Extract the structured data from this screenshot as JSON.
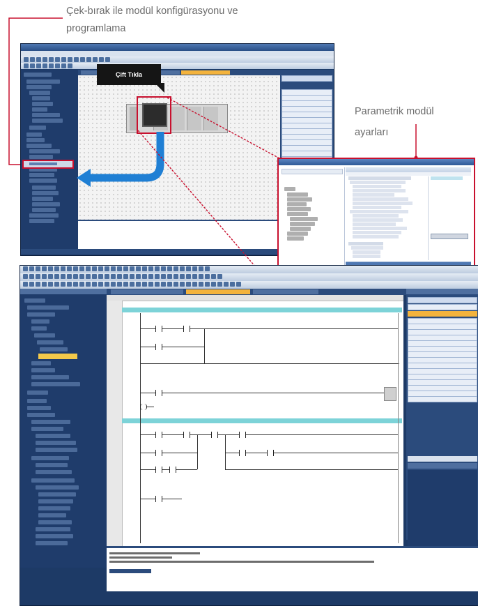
{
  "captions": {
    "top_line1": "Çek-bırak ile modül konfigürasyonu ve",
    "top_line2": "programlama",
    "right_line1": "Parametrik modül",
    "right_line2": "ayarları"
  },
  "callout": {
    "double_click": "Çift Tıkla"
  },
  "colors": {
    "accent_red": "#c8102e",
    "arrow_blue": "#1f7fd4",
    "window_navy": "#1d3a66"
  }
}
